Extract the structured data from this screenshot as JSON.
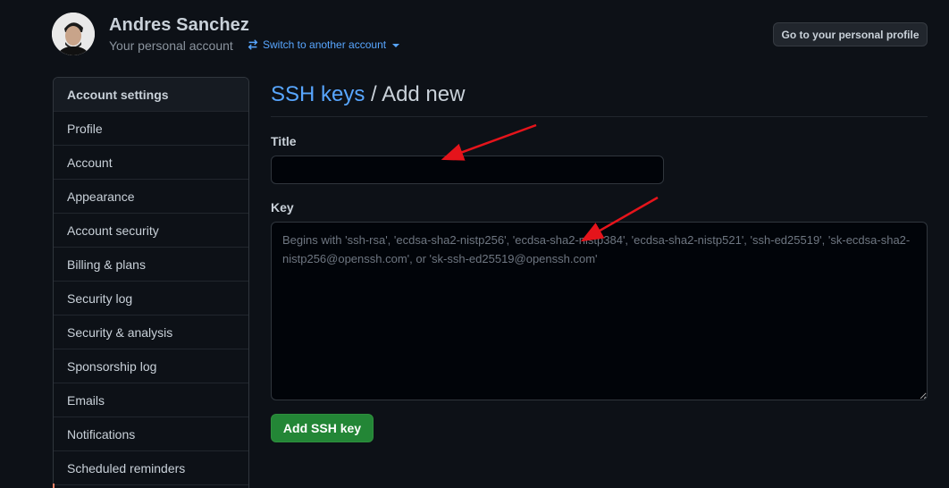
{
  "header": {
    "user_name": "Andres Sanchez",
    "account_type": "Your personal account",
    "switch_account_label": "Switch to another account",
    "profile_button_label": "Go to your personal profile"
  },
  "sidebar": {
    "title": "Account settings",
    "items": [
      {
        "label": "Profile"
      },
      {
        "label": "Account"
      },
      {
        "label": "Appearance"
      },
      {
        "label": "Account security"
      },
      {
        "label": "Billing & plans"
      },
      {
        "label": "Security log"
      },
      {
        "label": "Security & analysis"
      },
      {
        "label": "Sponsorship log"
      },
      {
        "label": "Emails"
      },
      {
        "label": "Notifications"
      },
      {
        "label": "Scheduled reminders"
      }
    ]
  },
  "main": {
    "breadcrumb_link": "SSH keys",
    "breadcrumb_separator": " / ",
    "breadcrumb_current": "Add new",
    "title_label": "Title",
    "title_value": "",
    "key_label": "Key",
    "key_value": "",
    "key_placeholder": "Begins with 'ssh-rsa', 'ecdsa-sha2-nistp256', 'ecdsa-sha2-nistp384', 'ecdsa-sha2-nistp521', 'ssh-ed25519', 'sk-ecdsa-sha2-nistp256@openssh.com', or 'sk-ssh-ed25519@openssh.com'",
    "submit_label": "Add SSH key"
  },
  "icons": {
    "switch": "arrow-switch-icon",
    "dropdown": "caret-down-icon"
  },
  "colors": {
    "background": "#0d1117",
    "link": "#58a6ff",
    "primary_button": "#238636",
    "annotation_arrow": "#e5141b"
  }
}
